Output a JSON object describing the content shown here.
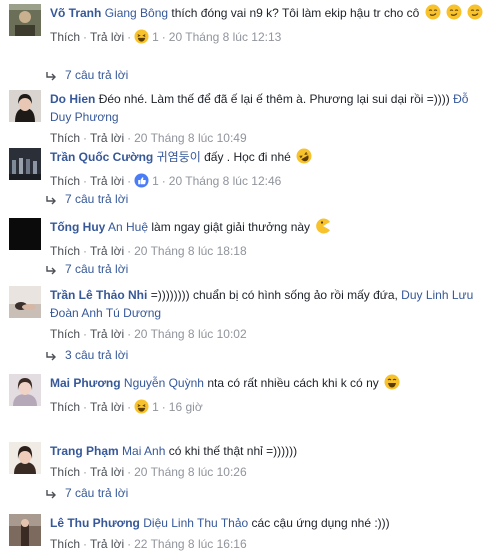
{
  "labels": {
    "like": "Thích",
    "reply": "Trả lời",
    "dot": "·"
  },
  "comments": [
    {
      "name": "Võ Tranh",
      "tag": "Giang Bông",
      "text": "thích đóng vai n9 k? Tôi làm ekip hậu tr cho cô",
      "emojis": [
        "smirk-emoji",
        "smirk-emoji",
        "smirk-emoji"
      ],
      "reaction": "haha",
      "reaction_count": "1",
      "time": "20 Tháng 8 lúc 12:13",
      "replies": "7 câu trả lời"
    },
    {
      "name": "Do Hien",
      "tag": "",
      "text": "Đéo nhé. Làm thế để đã ế lại ế thêm à. Phương lại sui dại rồi =))))",
      "tag2": "Đỗ Duy Phương",
      "time": "20 Tháng 8 lúc 10:49"
    },
    {
      "name": "Trần Quốc Cường",
      "tag": "귀염둥이",
      "text": "đấy . Học đi nhé",
      "emojis": [
        "rofl-emoji"
      ],
      "reaction": "like",
      "reaction_count": "1",
      "time": "20 Tháng 8 lúc 12:46",
      "replies": "7 câu trả lời"
    },
    {
      "name": "Tống Huy",
      "tag": "An Huệ",
      "text": "làm ngay giật giải thưởng này",
      "emojis": [
        "pacman-emoji"
      ],
      "time": "20 Tháng 8 lúc 18:18",
      "replies": "7 câu trả lời"
    },
    {
      "name": "Trần Lê Thảo Nhi",
      "tag": "",
      "text": "=)))))))) chuẩn bị có hình sống ảo rồi mấy đứa,",
      "tag2": "Duy Linh Lưu",
      "tag3": "Đoàn Anh Tú Dương",
      "time": "20 Tháng 8 lúc 10:02",
      "replies": "3 câu trả lời"
    },
    {
      "name": "Mai Phương",
      "tag": "Nguyễn Quỳnh",
      "text": "nta có rất nhiều cách khi k có ny",
      "emojis": [
        "laugh-emoji"
      ],
      "reaction": "haha",
      "reaction_count": "1",
      "time": "16 giờ"
    },
    {
      "name": "Trang Phạm",
      "tag": "Mai Anh",
      "text": "có khi thế thật nhỉ =))))))",
      "time": "20 Tháng 8 lúc 10:26",
      "replies": "7 câu trả lời"
    },
    {
      "name": "Lê Thu Phương",
      "tag": "Diệu Linh Thu Thảo",
      "text": "các cậu ứng dụng nhé :)))",
      "time": "22 Tháng 8 lúc 16:16"
    }
  ]
}
